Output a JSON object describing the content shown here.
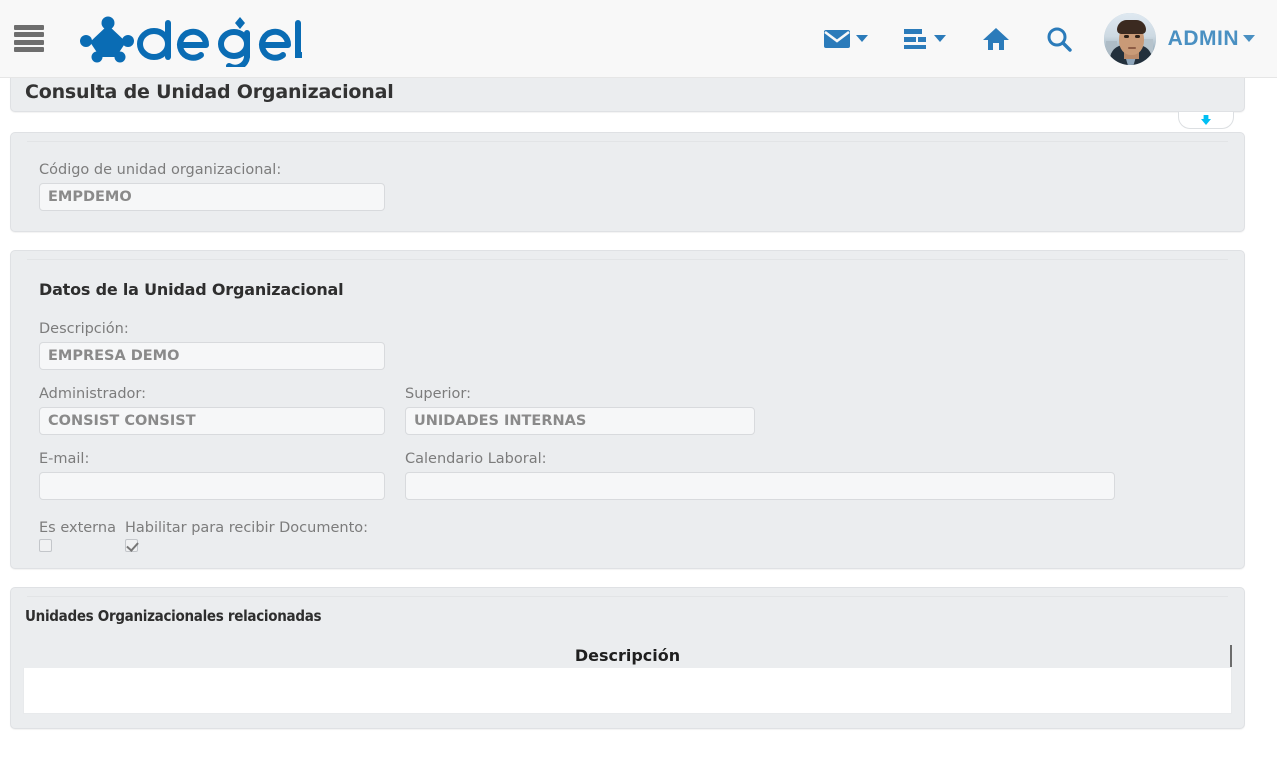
{
  "header": {
    "menu_icon": "hamburger-menu-icon",
    "brand": "degel",
    "icons": [
      {
        "name": "mail-icon",
        "has_caret": true
      },
      {
        "name": "tasks-icon",
        "has_caret": true
      },
      {
        "name": "home-icon",
        "has_caret": false
      },
      {
        "name": "search-icon",
        "has_caret": false
      }
    ],
    "avatar_alt": "user-avatar",
    "user_label": "ADMIN",
    "accent_color": "#2b7bba",
    "user_color": "#4a90c2"
  },
  "page": {
    "title": "Consulta de Unidad Organizacional",
    "collapse_icon": "arrow-down-icon",
    "collapse_arrow_color": "#00bff3"
  },
  "code_panel": {
    "label": "Código de unidad organizacional:",
    "value": "EMPDEMO",
    "placeholder": ""
  },
  "data_panel": {
    "heading": "Datos de la Unidad Organizacional",
    "descripcion": {
      "label": "Descripción:",
      "value": "EMPRESA DEMO",
      "placeholder": ""
    },
    "administrador": {
      "label": "Administrador:",
      "value": "CONSIST CONSIST",
      "placeholder": ""
    },
    "superior": {
      "label": "Superior:",
      "value": "UNIDADES INTERNAS",
      "placeholder": ""
    },
    "email": {
      "label": "E-mail:",
      "value": "",
      "placeholder": ""
    },
    "calendario": {
      "label": "Calendario Laboral:",
      "value": "",
      "placeholder": ""
    },
    "es_externa": {
      "label": "Es externa",
      "checked": false
    },
    "habilitar_documento": {
      "label": "Habilitar para recibir Documento:",
      "checked": true
    }
  },
  "relations_panel": {
    "heading": "Unidades Organizacionales relacionadas",
    "columns": [
      "Descripción"
    ],
    "rows": []
  }
}
